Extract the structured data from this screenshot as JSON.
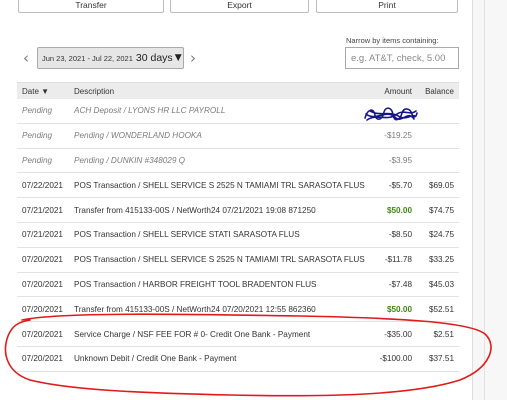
{
  "toolbar": {
    "transfer": "Transfer",
    "export": "Export",
    "print": "Print"
  },
  "date_filter": {
    "range": "Jun 23, 2021 - Jul 22, 2021",
    "days": "30 days",
    "prev_icon": "chevron-left",
    "next_icon": "chevron-right"
  },
  "filter": {
    "label": "Narrow by items containing:",
    "placeholder": "e.g. AT&T, check, 5.00"
  },
  "table": {
    "headers": {
      "date": "Date ▼",
      "description": "Description",
      "amount": "Amount",
      "balance": "Balance"
    },
    "rows": [
      {
        "date": "Pending",
        "description": "ACH Deposit / LYONS HR LLC PAYROLL",
        "amount": "",
        "balance": ""
      },
      {
        "date": "Pending",
        "description": "Pending / WONDERLAND HOOKA",
        "amount": "-$19.25",
        "balance": ""
      },
      {
        "date": "Pending",
        "description": "Pending / DUNKIN #348029 Q",
        "amount": "-$3.95",
        "balance": ""
      },
      {
        "date": "07/22/2021",
        "description": "POS Transaction / SHELL SERVICE S 2525 N TAMIAMI TRL SARASOTA FLUS",
        "amount": "-$5.70",
        "balance": "$69.05"
      },
      {
        "date": "07/21/2021",
        "description": "Transfer from 415133-00S / NetWorth24 07/21/2021 19:08 871250",
        "amount": "$50.00",
        "balance": "$74.75"
      },
      {
        "date": "07/21/2021",
        "description": "POS Transaction / SHELL SERVICE STATI SARASOTA FLUS",
        "amount": "-$8.50",
        "balance": "$24.75"
      },
      {
        "date": "07/20/2021",
        "description": "POS Transaction / SHELL SERVICE S 2525 N TAMIAMI TRL SARASOTA FLUS",
        "amount": "-$11.78",
        "balance": "$33.25"
      },
      {
        "date": "07/20/2021",
        "description": "POS Transaction / HARBOR FREIGHT TOOL BRADENTON FLUS",
        "amount": "-$7.48",
        "balance": "$45.03"
      },
      {
        "date": "07/20/2021",
        "description": "Transfer from 415133-00S / NetWorth24 07/20/2021 12:55 862360",
        "amount": "$50.00",
        "balance": "$52.51"
      },
      {
        "date": "07/20/2021",
        "description": "Service Charge / NSF FEE FOR # 0- Credit One Bank - Payment",
        "amount": "-$35.00",
        "balance": "$2.51"
      },
      {
        "date": "07/20/2021",
        "description": "Unknown Debit / Credit One Bank - Payment",
        "amount": "-$100.00",
        "balance": "$37.51"
      }
    ]
  },
  "colors": {
    "credit": "#3f8a14",
    "annotation": "#e11a1a",
    "scribble": "#16168a"
  }
}
